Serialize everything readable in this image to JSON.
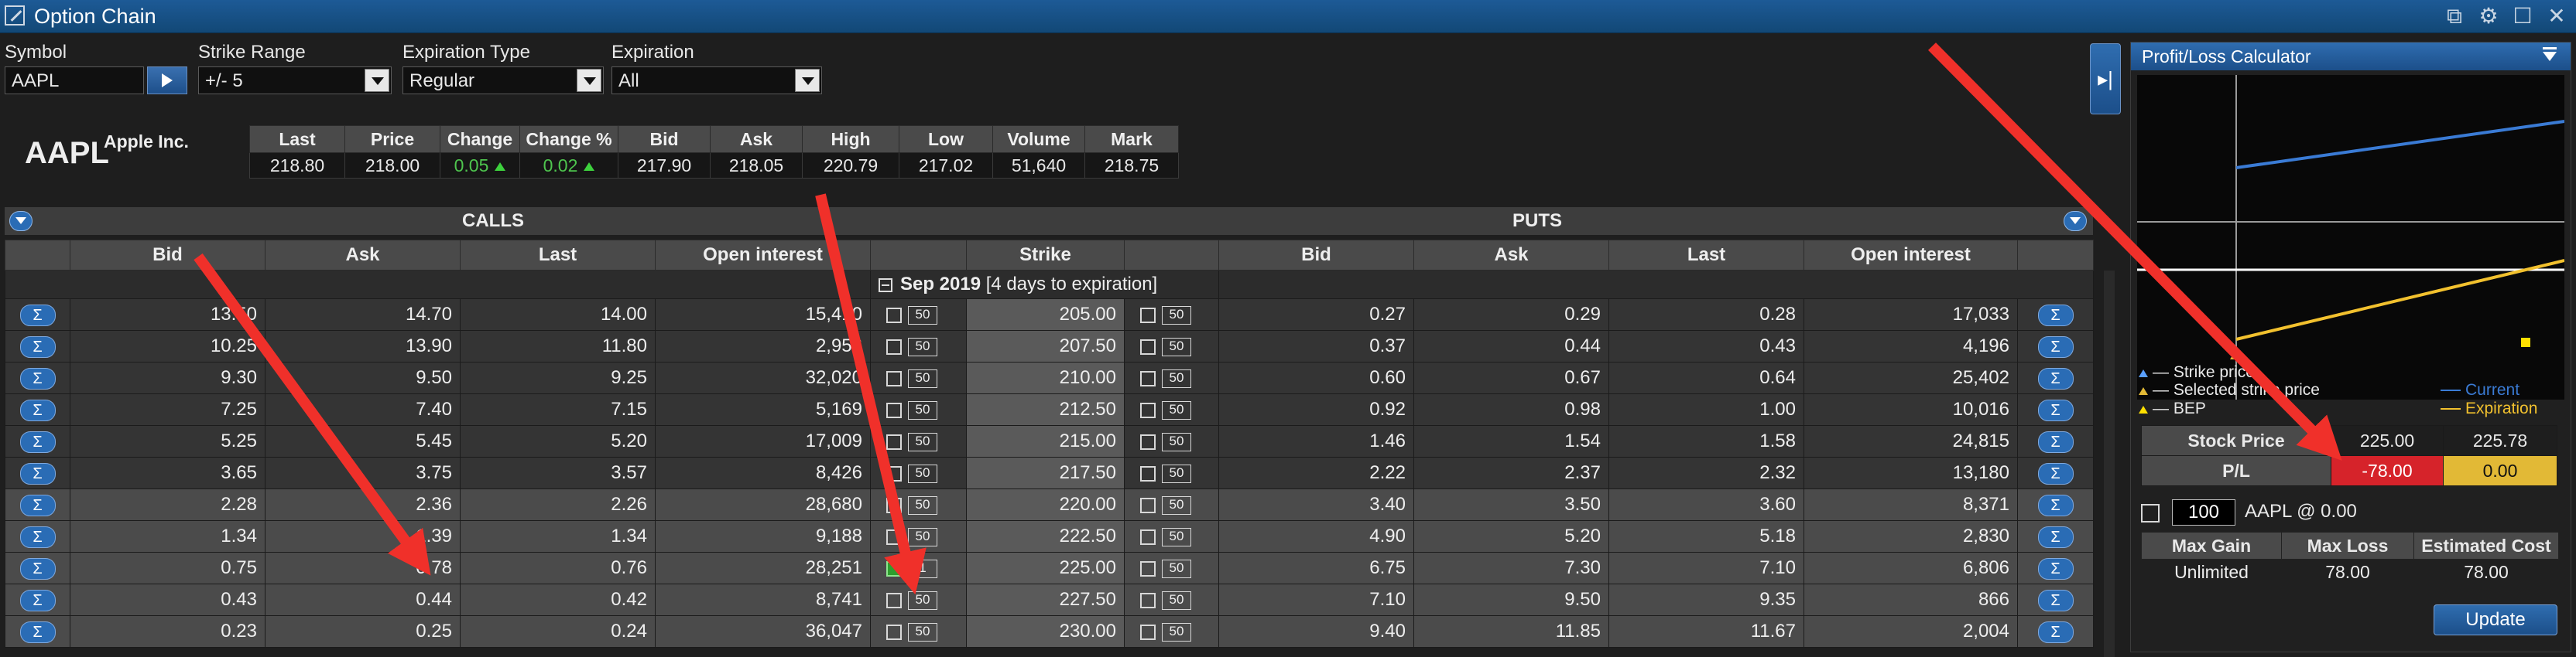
{
  "window": {
    "title": "Option Chain"
  },
  "controls": {
    "symbol_label": "Symbol",
    "symbol_value": "AAPL",
    "strike_range_label": "Strike Range",
    "strike_range_value": "+/- 5",
    "expiration_type_label": "Expiration Type",
    "expiration_type_value": "Regular",
    "expiration_label": "Expiration",
    "expiration_value": "All"
  },
  "quote": {
    "ticker": "AAPL",
    "company": "Apple Inc.",
    "headers": [
      "Last",
      "Price",
      "Change",
      "Change %",
      "Bid",
      "Ask",
      "High",
      "Low",
      "Volume",
      "Mark"
    ],
    "values": [
      "218.80",
      "218.00",
      "0.05",
      "0.02",
      "217.90",
      "218.05",
      "220.79",
      "217.02",
      "51,640",
      "218.75"
    ]
  },
  "chain": {
    "calls_label": "CALLS",
    "puts_label": "PUTS",
    "columns": {
      "calls_bid": "Bid",
      "calls_ask": "Ask",
      "calls_last": "Last",
      "calls_oi": "Open interest",
      "strike": "Strike",
      "puts_bid": "Bid",
      "puts_ask": "Ask",
      "puts_last": "Last",
      "puts_oi": "Open interest"
    },
    "expiration_group": {
      "month": "Sep 2019",
      "note": "[4 days to expiration]"
    },
    "sigma_symbol": "Σ",
    "rows": [
      {
        "c_bid": "13.50",
        "c_ask": "14.70",
        "c_last": "14.00",
        "c_oi": "15,410",
        "c_qty": "50",
        "strike": "205.00",
        "p_qty": "50",
        "p_bid": "0.27",
        "p_ask": "0.29",
        "p_last": "0.28",
        "p_oi": "17,033"
      },
      {
        "c_bid": "10.25",
        "c_ask": "13.90",
        "c_last": "11.80",
        "c_oi": "2,956",
        "c_qty": "50",
        "strike": "207.50",
        "p_qty": "50",
        "p_bid": "0.37",
        "p_ask": "0.44",
        "p_last": "0.43",
        "p_oi": "4,196"
      },
      {
        "c_bid": "9.30",
        "c_ask": "9.50",
        "c_last": "9.25",
        "c_oi": "32,020",
        "c_qty": "50",
        "strike": "210.00",
        "p_qty": "50",
        "p_bid": "0.60",
        "p_ask": "0.67",
        "p_last": "0.64",
        "p_oi": "25,402"
      },
      {
        "c_bid": "7.25",
        "c_ask": "7.40",
        "c_last": "7.15",
        "c_oi": "5,169",
        "c_qty": "50",
        "strike": "212.50",
        "p_qty": "50",
        "p_bid": "0.92",
        "p_ask": "0.98",
        "p_last": "1.00",
        "p_oi": "10,016"
      },
      {
        "c_bid": "5.25",
        "c_ask": "5.45",
        "c_last": "5.20",
        "c_oi": "17,009",
        "c_qty": "50",
        "strike": "215.00",
        "p_qty": "50",
        "p_bid": "1.46",
        "p_ask": "1.54",
        "p_last": "1.58",
        "p_oi": "24,815"
      },
      {
        "c_bid": "3.65",
        "c_ask": "3.75",
        "c_last": "3.57",
        "c_oi": "8,426",
        "c_qty": "50",
        "strike": "217.50",
        "p_qty": "50",
        "p_bid": "2.22",
        "p_ask": "2.37",
        "p_last": "2.32",
        "p_oi": "13,180"
      },
      {
        "c_bid": "2.28",
        "c_ask": "2.36",
        "c_last": "2.26",
        "c_oi": "28,680",
        "c_qty": "50",
        "strike": "220.00",
        "p_qty": "50",
        "p_bid": "3.40",
        "p_ask": "3.50",
        "p_last": "3.60",
        "p_oi": "8,371"
      },
      {
        "c_bid": "1.34",
        "c_ask": "1.39",
        "c_last": "1.34",
        "c_oi": "9,188",
        "c_qty": "50",
        "strike": "222.50",
        "p_qty": "50",
        "p_bid": "4.90",
        "p_ask": "5.20",
        "p_last": "5.18",
        "p_oi": "2,830"
      },
      {
        "c_bid": "0.75",
        "c_ask": "0.78",
        "c_last": "0.76",
        "c_oi": "28,251",
        "c_qty": "1",
        "c_checked": true,
        "strike": "225.00",
        "p_qty": "50",
        "p_bid": "6.75",
        "p_ask": "7.30",
        "p_last": "7.10",
        "p_oi": "6,806"
      },
      {
        "c_bid": "0.43",
        "c_ask": "0.44",
        "c_last": "0.42",
        "c_oi": "8,741",
        "c_qty": "50",
        "strike": "227.50",
        "p_qty": "50",
        "p_bid": "7.10",
        "p_ask": "9.50",
        "p_last": "9.35",
        "p_oi": "866"
      },
      {
        "c_bid": "0.23",
        "c_ask": "0.25",
        "c_last": "0.24",
        "c_oi": "36,047",
        "c_qty": "50",
        "strike": "230.00",
        "p_qty": "50",
        "p_bid": "9.40",
        "p_ask": "11.85",
        "p_last": "11.67",
        "p_oi": "2,004"
      }
    ]
  },
  "pl": {
    "title": "Profit/Loss Calculator",
    "legend": {
      "strike_price": "Strike price",
      "selected_strike": "Selected strike price",
      "bep": "BEP",
      "current": "Current",
      "expiration": "Expiration"
    },
    "stock_price_label": "Stock Price",
    "stock_price_1": "225.00",
    "stock_price_2": "225.78",
    "pl_label": "P/L",
    "pl_1": "-78.00",
    "pl_2": "0.00",
    "qty": "100",
    "position_text": "AAPL @ 0.00",
    "headers": [
      "Max Gain",
      "Max Loss",
      "Estimated Cost"
    ],
    "values": [
      "Unlimited",
      "78.00",
      "78.00"
    ],
    "update_label": "Update",
    "colors": {
      "current": "#3a7bd5",
      "expiration": "#f2c12e",
      "loss": "#d6232a",
      "neutral": "#e2b936"
    }
  }
}
